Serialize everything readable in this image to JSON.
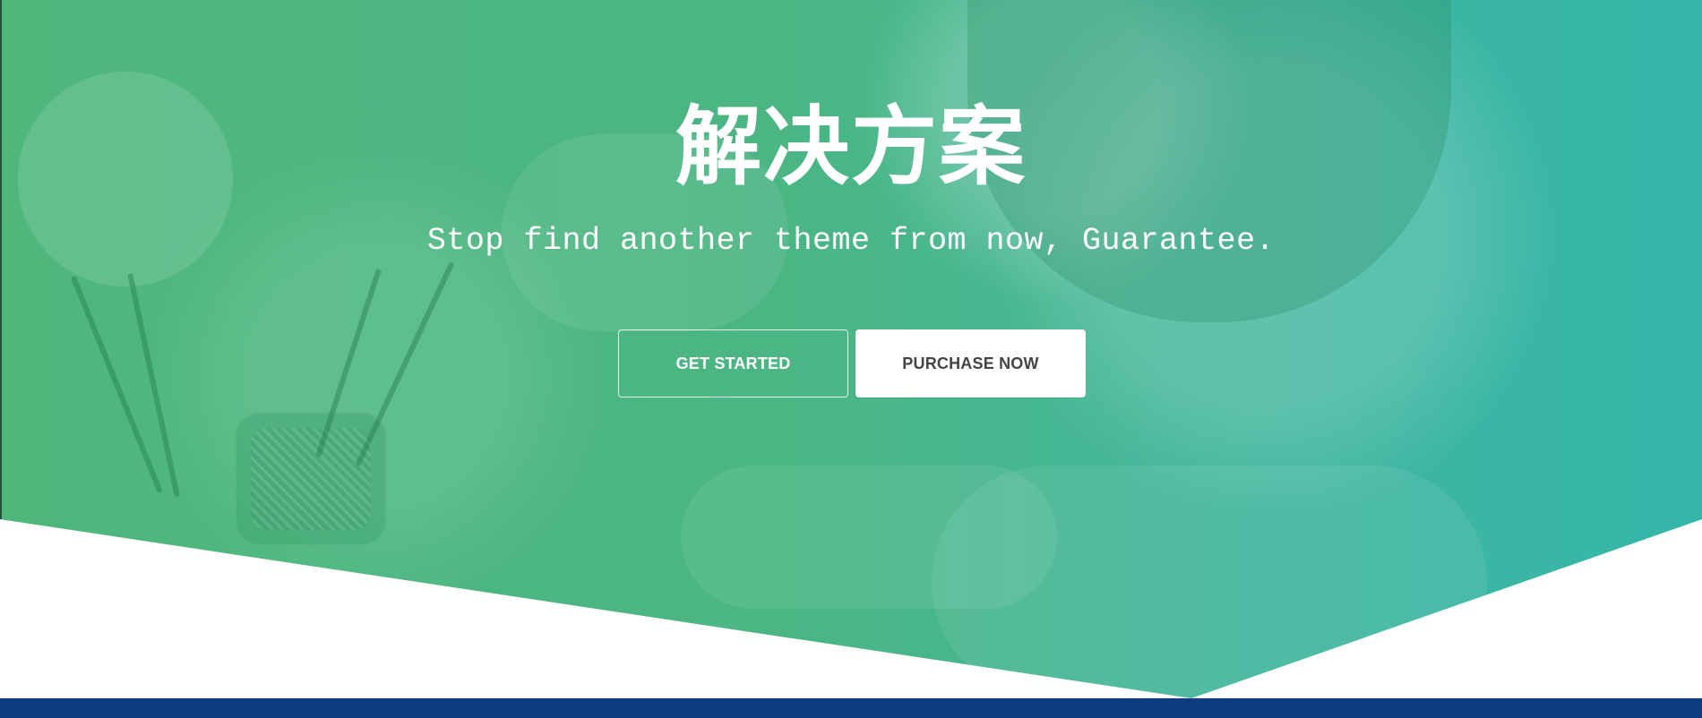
{
  "hero": {
    "title": "解决方案",
    "subtitle": "Stop find another theme from now, Guarantee.",
    "buttons": {
      "get_started": "GET STARTED",
      "purchase_now": "PURCHASE NOW"
    }
  },
  "colors": {
    "hero_green_left": "#4fb77c",
    "hero_green_mid": "#4bb684",
    "hero_teal_right": "#35b6aa",
    "bottom_bar": "#0c3c82",
    "button_solid_bg": "#ffffff",
    "button_solid_text": "#444444",
    "text": "#ffffff"
  }
}
